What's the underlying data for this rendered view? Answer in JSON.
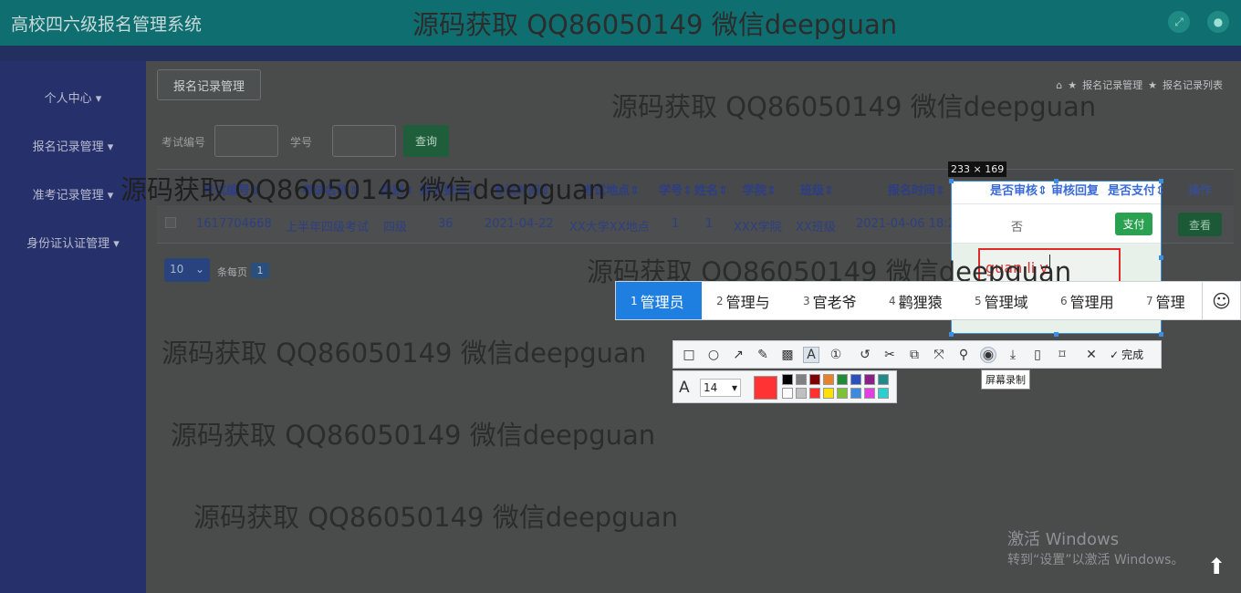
{
  "app": {
    "title": "高校四六级报名管理系统"
  },
  "sidebar": {
    "items": [
      {
        "label": "个人中心"
      },
      {
        "label": "报名记录管理"
      },
      {
        "label": "准考记录管理"
      },
      {
        "label": "身份证认证管理"
      }
    ]
  },
  "main": {
    "tab_label": "报名记录管理",
    "breadcrumb": [
      "报名记录管理",
      "报名记录列表"
    ],
    "filter": {
      "exam_no_label": "考试编号",
      "student_no_label": "学号",
      "query_label": "查询"
    },
    "table": {
      "headers": [
        "考试编号",
        "考试名称",
        "类别",
        "报名费用",
        "考试时间",
        "考试地点",
        "学号",
        "姓名",
        "学院",
        "班级",
        "报名时间",
        "是否审核",
        "审核回复",
        "是否支付",
        "操作"
      ],
      "rows": [
        {
          "exam_no": "1617704668",
          "exam_name": "上半年四级考试",
          "category": "四级",
          "fee": "36",
          "exam_date": "2021-04-22",
          "location": "XX大学XX地点",
          "student_no": "1",
          "name": "1",
          "college": "XXX学院",
          "class": "XX班级",
          "signup_time": "2021-04-06 18:25:56",
          "audited": "否",
          "pay_label": "支付",
          "view_label": "查看"
        }
      ]
    },
    "pager": {
      "page_size": "10",
      "per_page_label": "条每页",
      "current_page": "1"
    }
  },
  "watermarks": [
    "源码获取 QQ86050149 微信deepguan",
    "源码获取 QQ86050149 微信deepguan",
    "源码获取 QQ86050149 微信deepguan",
    "源码获取 QQ86050149 微信deepguan",
    "源码获取 QQ86050149 微信deepguan",
    "源码获取 QQ86050149 微信deepguan",
    "源码获取 QQ86050149 微信deepguan"
  ],
  "screenshot_tool": {
    "size_label": "233 × 169",
    "typed_text": "guan li y",
    "tooltip": "屏幕录制",
    "done_label": "完成",
    "font_size": "14",
    "selected_color": "#ff3333",
    "colors": [
      "#000000",
      "#808080",
      "#800000",
      "#e8812a",
      "#1f8a3a",
      "#2b4fc2",
      "#8a1f8a",
      "#1f8a8a",
      "#ffffff",
      "#c0c0c0",
      "#ff3030",
      "#ffe000",
      "#7fc23a",
      "#3a8ae0",
      "#e040e0",
      "#2ad0d0"
    ]
  },
  "ime": {
    "candidates": [
      {
        "n": "1",
        "text": "管理员"
      },
      {
        "n": "2",
        "text": "管理与"
      },
      {
        "n": "3",
        "text": "官老爷"
      },
      {
        "n": "4",
        "text": "鹳狸猿"
      },
      {
        "n": "5",
        "text": "管理域"
      },
      {
        "n": "6",
        "text": "管理用"
      },
      {
        "n": "7",
        "text": "管理"
      }
    ]
  },
  "windows": {
    "activate_title": "激活 Windows",
    "activate_sub": "转到“设置”以激活 Windows。"
  }
}
